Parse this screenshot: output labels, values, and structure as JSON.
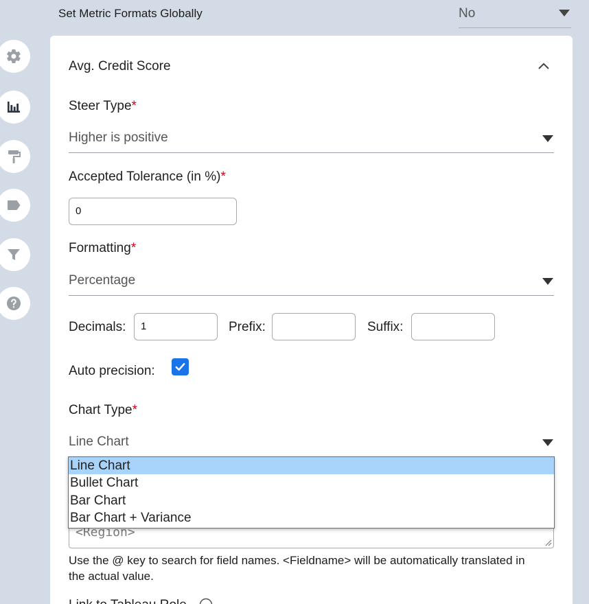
{
  "global": {
    "label": "Set Metric Formats Globally",
    "value": "No"
  },
  "rail": {
    "icons": [
      "gear-icon",
      "bar-chart-icon",
      "paint-roller-icon",
      "tag-icon",
      "filter-icon",
      "help-icon"
    ]
  },
  "card": {
    "title": "Avg. Credit Score",
    "steer_type": {
      "label": "Steer Type",
      "required": "*",
      "value": "Higher is positive"
    },
    "tolerance": {
      "label": "Accepted Tolerance (in %)",
      "required": "*",
      "value": "0"
    },
    "formatting": {
      "label": "Formatting",
      "required": "*",
      "value": "Percentage"
    },
    "decimals": {
      "label": "Decimals:",
      "value": "1"
    },
    "prefix": {
      "label": "Prefix:",
      "value": ""
    },
    "suffix": {
      "label": "Suffix:",
      "value": ""
    },
    "auto_precision": {
      "label": "Auto precision:",
      "checked": true
    },
    "chart_type": {
      "label": "Chart Type",
      "required": "*",
      "value": "Line Chart",
      "options": [
        "Line Chart",
        "Bullet Chart",
        "Bar Chart",
        "Bar Chart + Variance"
      ],
      "selected_index": 0
    },
    "textarea": {
      "value": "<Region>"
    },
    "help_text": "Use the @ key to search for field names. <Fieldname> will be automatically translated in the actual value.",
    "next_label": "Link to Tableau Role"
  },
  "colors": {
    "accent": "#1a73e8",
    "required": "#d0021b",
    "selected_option": "#a8d4fc",
    "background": "#d3dce6"
  }
}
